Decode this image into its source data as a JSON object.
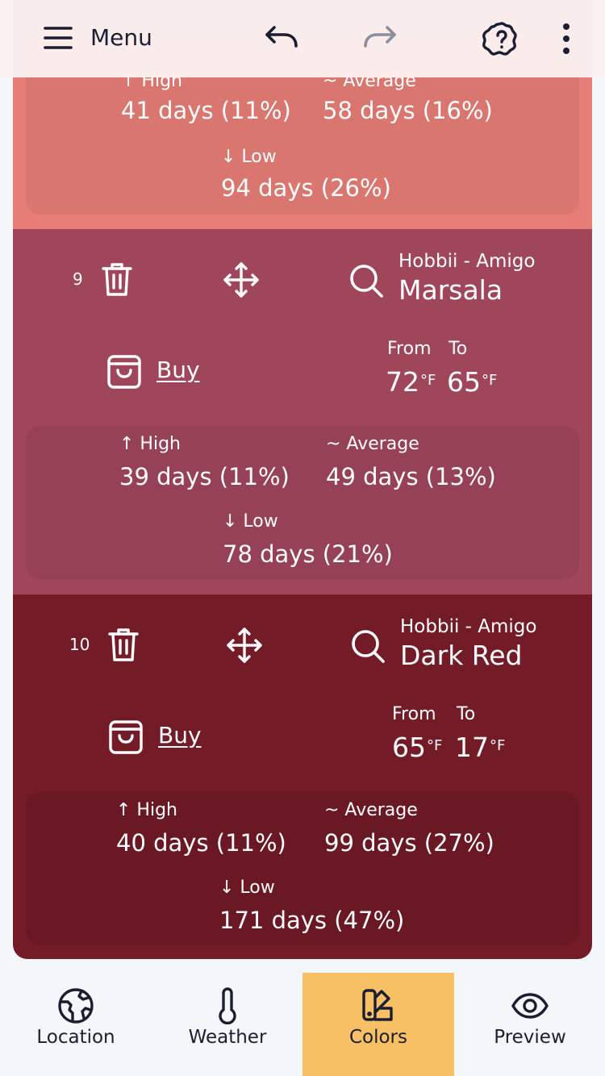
{
  "header": {
    "menu_label": "Menu"
  },
  "cards": [
    {
      "stats": {
        "high_label": "↑ High",
        "high_value": "41 days (11%)",
        "avg_label": "~ Average",
        "avg_value": "58 days (16%)",
        "low_label": "↓ Low",
        "low_value": "94 days (26%)"
      }
    },
    {
      "index": "9",
      "brand": "Hobbii - Amigo",
      "color_name": "Marsala",
      "buy_label": "Buy",
      "from_label": "From",
      "to_label": "To",
      "from_temp": "72",
      "to_temp": "65",
      "unit": "°F",
      "bg": "#a0465b",
      "stats": {
        "high_label": "↑ High",
        "high_value": "39 days (11%)",
        "avg_label": "~ Average",
        "avg_value": "49 days (13%)",
        "low_label": "↓ Low",
        "low_value": "78 days (21%)"
      }
    },
    {
      "index": "10",
      "brand": "Hobbii - Amigo",
      "color_name": "Dark Red",
      "buy_label": "Buy",
      "from_label": "From",
      "to_label": "To",
      "from_temp": "65",
      "to_temp": "17",
      "unit": "°F",
      "bg": "#741b28",
      "stats": {
        "high_label": "↑ High",
        "high_value": "40 days (11%)",
        "avg_label": "~ Average",
        "avg_value": "99 days (27%)",
        "low_label": "↓ Low",
        "low_value": "171 days (47%)"
      }
    }
  ],
  "nav": {
    "items": [
      {
        "label": "Location",
        "icon": "globe-icon"
      },
      {
        "label": "Weather",
        "icon": "thermometer-icon"
      },
      {
        "label": "Colors",
        "icon": "swatch-icon",
        "active": true
      },
      {
        "label": "Preview",
        "icon": "eye-icon"
      }
    ]
  },
  "colors": {
    "top_card": "#e67d76",
    "marsala": "#a0465b",
    "dark_red": "#741b28",
    "active_tab": "#f7c064",
    "ink": "#1b1e33"
  }
}
